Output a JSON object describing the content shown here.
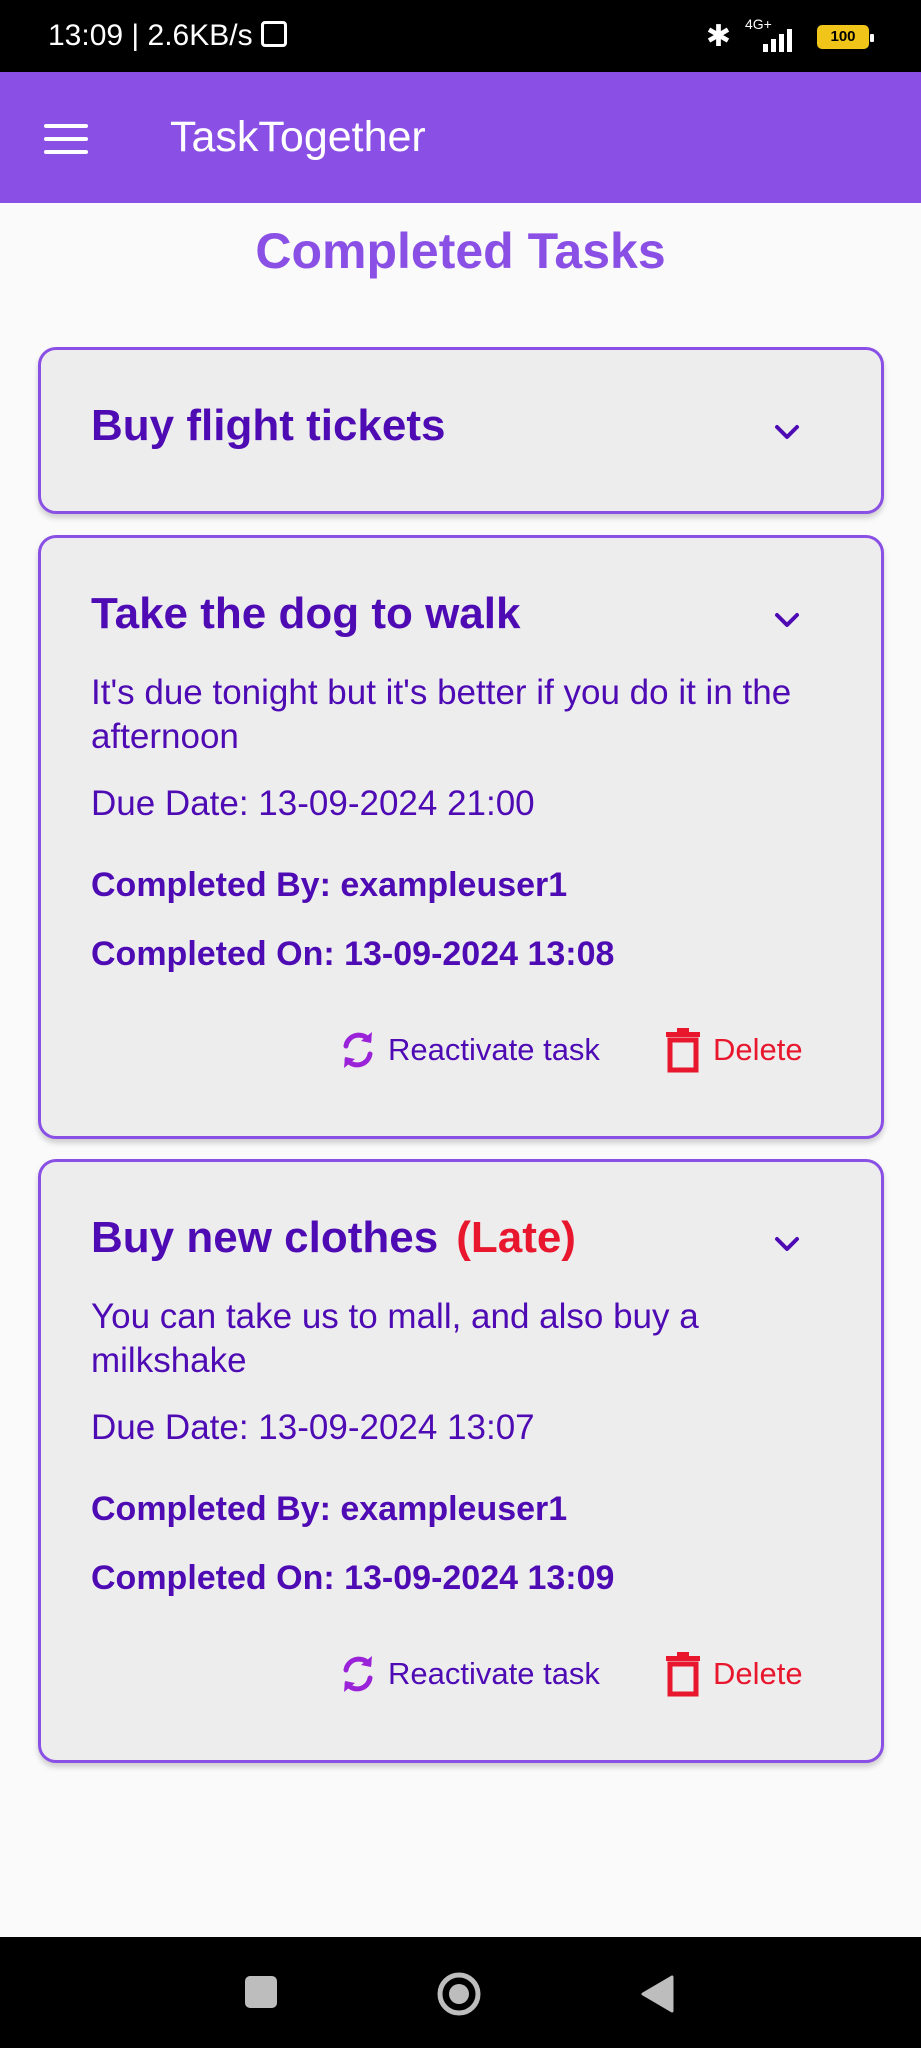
{
  "status_bar": {
    "time_speed": "13:09 | 2.6KB/s",
    "network_label": "4G+",
    "battery": "100"
  },
  "app_bar": {
    "title": "TaskTogether"
  },
  "page": {
    "title": "Completed Tasks"
  },
  "tasks": [
    {
      "title": "Buy flight tickets",
      "expanded": false
    },
    {
      "title": "Take the dog to walk",
      "description": "It's due tonight but it's better if you do it in the afternoon",
      "due": "Due Date: 13-09-2024 21:00",
      "completed_by": "Completed By: exampleuser1",
      "completed_on": "Completed On: 13-09-2024 13:08",
      "reactivate_label": "Reactivate task",
      "delete_label": "Delete",
      "expanded": true
    },
    {
      "title": "Buy new clothes",
      "late_label": "(Late)",
      "description": "You can take us to mall, and also buy a milkshake",
      "due": "Due Date: 13-09-2024 13:07",
      "completed_by": "Completed By: exampleuser1",
      "completed_on": "Completed On: 13-09-2024 13:09",
      "reactivate_label": "Reactivate task",
      "delete_label": "Delete",
      "expanded": true
    }
  ],
  "colors": {
    "primary": "#8a50e6",
    "text_primary": "#4e0bb4",
    "danger": "#e8172e",
    "card_bg": "#ededee"
  },
  "icons": {
    "menu": "menu-icon",
    "chevron": "chevron-down-icon",
    "reactivate": "refresh-icon",
    "delete": "trash-icon"
  }
}
